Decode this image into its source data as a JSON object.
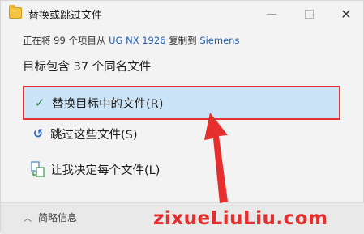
{
  "window": {
    "title": "替换或跳过文件",
    "minimize_glyph": "—",
    "close_glyph": "✕"
  },
  "info": {
    "prefix": "正在将 99 个项目从 ",
    "source": "UG NX 1926",
    "middle": " 复制到 ",
    "destination": "Siemens",
    "summary": "目标包含 37 个同名文件"
  },
  "options": [
    {
      "label": "替换目标中的文件(R)",
      "icon": "check-icon",
      "glyph": "✓",
      "selected": true
    },
    {
      "label": "跳过这些文件(S)",
      "icon": "skip-arrow-icon",
      "glyph": "↺",
      "selected": false
    },
    {
      "label": "让我决定每个文件(L)",
      "icon": "decide-files-icon",
      "glyph": "",
      "selected": false
    }
  ],
  "footer": {
    "details_label": "简略信息",
    "chevron_glyph": "︿"
  },
  "watermark": "zixueLiuLiu.com",
  "colors": {
    "accent": "#1f5fae",
    "selected_bg": "#cce4f7",
    "highlight_red": "#e53232"
  }
}
